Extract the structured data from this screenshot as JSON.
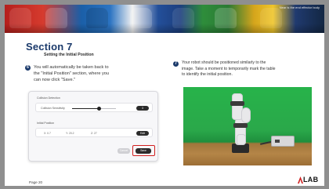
{
  "header": {
    "caption": "Near is the end effector body"
  },
  "section": {
    "title": "Section 7",
    "subtitle": "Setting the Initial Position"
  },
  "steps": [
    {
      "num": "6",
      "text_lines": [
        "You will automatically be taken back to",
        "the \"Initial Position\" section, where you",
        "can now click \"Save.\""
      ]
    },
    {
      "num": "7",
      "text_lines": [
        "Your robot should be positioned similarly to the",
        "image. Take a moment to temporarily mark the table",
        "to identify the initial position."
      ]
    }
  ],
  "panel": {
    "collision_heading": "Collision Detection",
    "sensitivity_label": "Collision Sensitivity",
    "sensitivity_value": "3",
    "sensitivity_level": 0.62,
    "initial_heading": "Initial Position",
    "coords": [
      "X: 0.7",
      "Y: 20.2",
      "Z: 27"
    ],
    "edit_label": "Edit",
    "cancel_label": "Cancel",
    "save_label": "Save"
  },
  "footer": {
    "page": "Page 20",
    "logo_text": "LAB"
  }
}
